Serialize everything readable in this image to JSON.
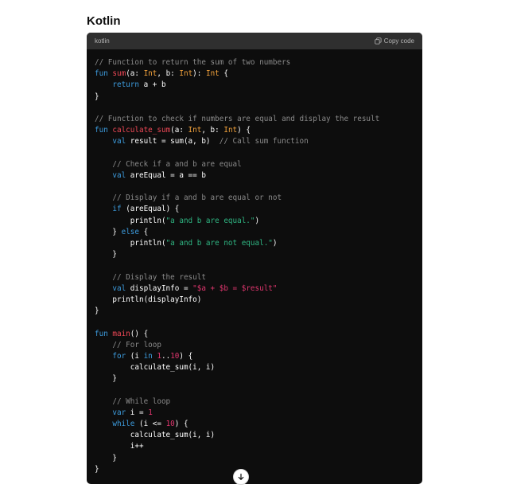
{
  "page": {
    "heading": "Kotlin"
  },
  "code_block": {
    "language_label": "kotlin",
    "copy_label": "Copy code",
    "icons": {
      "copy": "copy-icon",
      "scroll": "arrow-down-icon"
    },
    "colors": {
      "background": "#0d0d0d",
      "header": "#2f2f2f",
      "comment": "#8a8a8a",
      "keyword": "#3d9cde",
      "function": "#ef4856",
      "type": "#f2a23c",
      "string": "#2fb582",
      "number": "#e0366e"
    },
    "lines": [
      [
        {
          "t": "// Function to return the sum of two numbers",
          "c": "comment"
        }
      ],
      [
        {
          "t": "fun ",
          "c": "keyword"
        },
        {
          "t": "sum",
          "c": "func"
        },
        {
          "t": "(a: ",
          "c": "plain"
        },
        {
          "t": "Int",
          "c": "type"
        },
        {
          "t": ", b: ",
          "c": "plain"
        },
        {
          "t": "Int",
          "c": "type"
        },
        {
          "t": "): ",
          "c": "plain"
        },
        {
          "t": "Int",
          "c": "type"
        },
        {
          "t": " {",
          "c": "plain"
        }
      ],
      [
        {
          "t": "    ",
          "c": "plain"
        },
        {
          "t": "return",
          "c": "keyword"
        },
        {
          "t": " a + b",
          "c": "plain"
        }
      ],
      [
        {
          "t": "}",
          "c": "plain"
        }
      ],
      [],
      [
        {
          "t": "// Function to check if numbers are equal and display the result",
          "c": "comment"
        }
      ],
      [
        {
          "t": "fun ",
          "c": "keyword"
        },
        {
          "t": "calculate_sum",
          "c": "func"
        },
        {
          "t": "(a: ",
          "c": "plain"
        },
        {
          "t": "Int",
          "c": "type"
        },
        {
          "t": ", b: ",
          "c": "plain"
        },
        {
          "t": "Int",
          "c": "type"
        },
        {
          "t": ") {",
          "c": "plain"
        }
      ],
      [
        {
          "t": "    ",
          "c": "plain"
        },
        {
          "t": "val",
          "c": "keyword"
        },
        {
          "t": " result = sum(a, b)  ",
          "c": "plain"
        },
        {
          "t": "// Call sum function",
          "c": "comment"
        }
      ],
      [],
      [
        {
          "t": "    ",
          "c": "plain"
        },
        {
          "t": "// Check if a and b are equal",
          "c": "comment"
        }
      ],
      [
        {
          "t": "    ",
          "c": "plain"
        },
        {
          "t": "val",
          "c": "keyword"
        },
        {
          "t": " areEqual = a == b",
          "c": "plain"
        }
      ],
      [],
      [
        {
          "t": "    ",
          "c": "plain"
        },
        {
          "t": "// Display if a and b are equal or not",
          "c": "comment"
        }
      ],
      [
        {
          "t": "    ",
          "c": "plain"
        },
        {
          "t": "if",
          "c": "keyword"
        },
        {
          "t": " (areEqual) {",
          "c": "plain"
        }
      ],
      [
        {
          "t": "        println(",
          "c": "plain"
        },
        {
          "t": "\"a and b are equal.\"",
          "c": "string"
        },
        {
          "t": ")",
          "c": "plain"
        }
      ],
      [
        {
          "t": "    } ",
          "c": "plain"
        },
        {
          "t": "else",
          "c": "keyword"
        },
        {
          "t": " {",
          "c": "plain"
        }
      ],
      [
        {
          "t": "        println(",
          "c": "plain"
        },
        {
          "t": "\"a and b are not equal.\"",
          "c": "string"
        },
        {
          "t": ")",
          "c": "plain"
        }
      ],
      [
        {
          "t": "    }",
          "c": "plain"
        }
      ],
      [],
      [
        {
          "t": "    ",
          "c": "plain"
        },
        {
          "t": "// Display the result",
          "c": "comment"
        }
      ],
      [
        {
          "t": "    ",
          "c": "plain"
        },
        {
          "t": "val",
          "c": "keyword"
        },
        {
          "t": " displayInfo = ",
          "c": "plain"
        },
        {
          "t": "\"$a + $b = $result\"",
          "c": "number"
        }
      ],
      [
        {
          "t": "    println(displayInfo)",
          "c": "plain"
        }
      ],
      [
        {
          "t": "}",
          "c": "plain"
        }
      ],
      [],
      [
        {
          "t": "fun ",
          "c": "keyword"
        },
        {
          "t": "main",
          "c": "func"
        },
        {
          "t": "() {",
          "c": "plain"
        }
      ],
      [
        {
          "t": "    ",
          "c": "plain"
        },
        {
          "t": "// For loop",
          "c": "comment"
        }
      ],
      [
        {
          "t": "    ",
          "c": "plain"
        },
        {
          "t": "for",
          "c": "keyword"
        },
        {
          "t": " (i ",
          "c": "plain"
        },
        {
          "t": "in",
          "c": "keyword"
        },
        {
          "t": " ",
          "c": "plain"
        },
        {
          "t": "1",
          "c": "number"
        },
        {
          "t": "..",
          "c": "plain"
        },
        {
          "t": "10",
          "c": "number"
        },
        {
          "t": ") {",
          "c": "plain"
        }
      ],
      [
        {
          "t": "        calculate_sum(i, i)",
          "c": "plain"
        }
      ],
      [
        {
          "t": "    }",
          "c": "plain"
        }
      ],
      [],
      [
        {
          "t": "    ",
          "c": "plain"
        },
        {
          "t": "// While loop",
          "c": "comment"
        }
      ],
      [
        {
          "t": "    ",
          "c": "plain"
        },
        {
          "t": "var",
          "c": "keyword"
        },
        {
          "t": " i = ",
          "c": "plain"
        },
        {
          "t": "1",
          "c": "number"
        }
      ],
      [
        {
          "t": "    ",
          "c": "plain"
        },
        {
          "t": "while",
          "c": "keyword"
        },
        {
          "t": " (i <= ",
          "c": "plain"
        },
        {
          "t": "10",
          "c": "number"
        },
        {
          "t": ") {",
          "c": "plain"
        }
      ],
      [
        {
          "t": "        calculate_sum(i, i)",
          "c": "plain"
        }
      ],
      [
        {
          "t": "        i++",
          "c": "plain"
        }
      ],
      [
        {
          "t": "    }",
          "c": "plain"
        }
      ],
      [
        {
          "t": "}",
          "c": "plain"
        }
      ]
    ]
  }
}
